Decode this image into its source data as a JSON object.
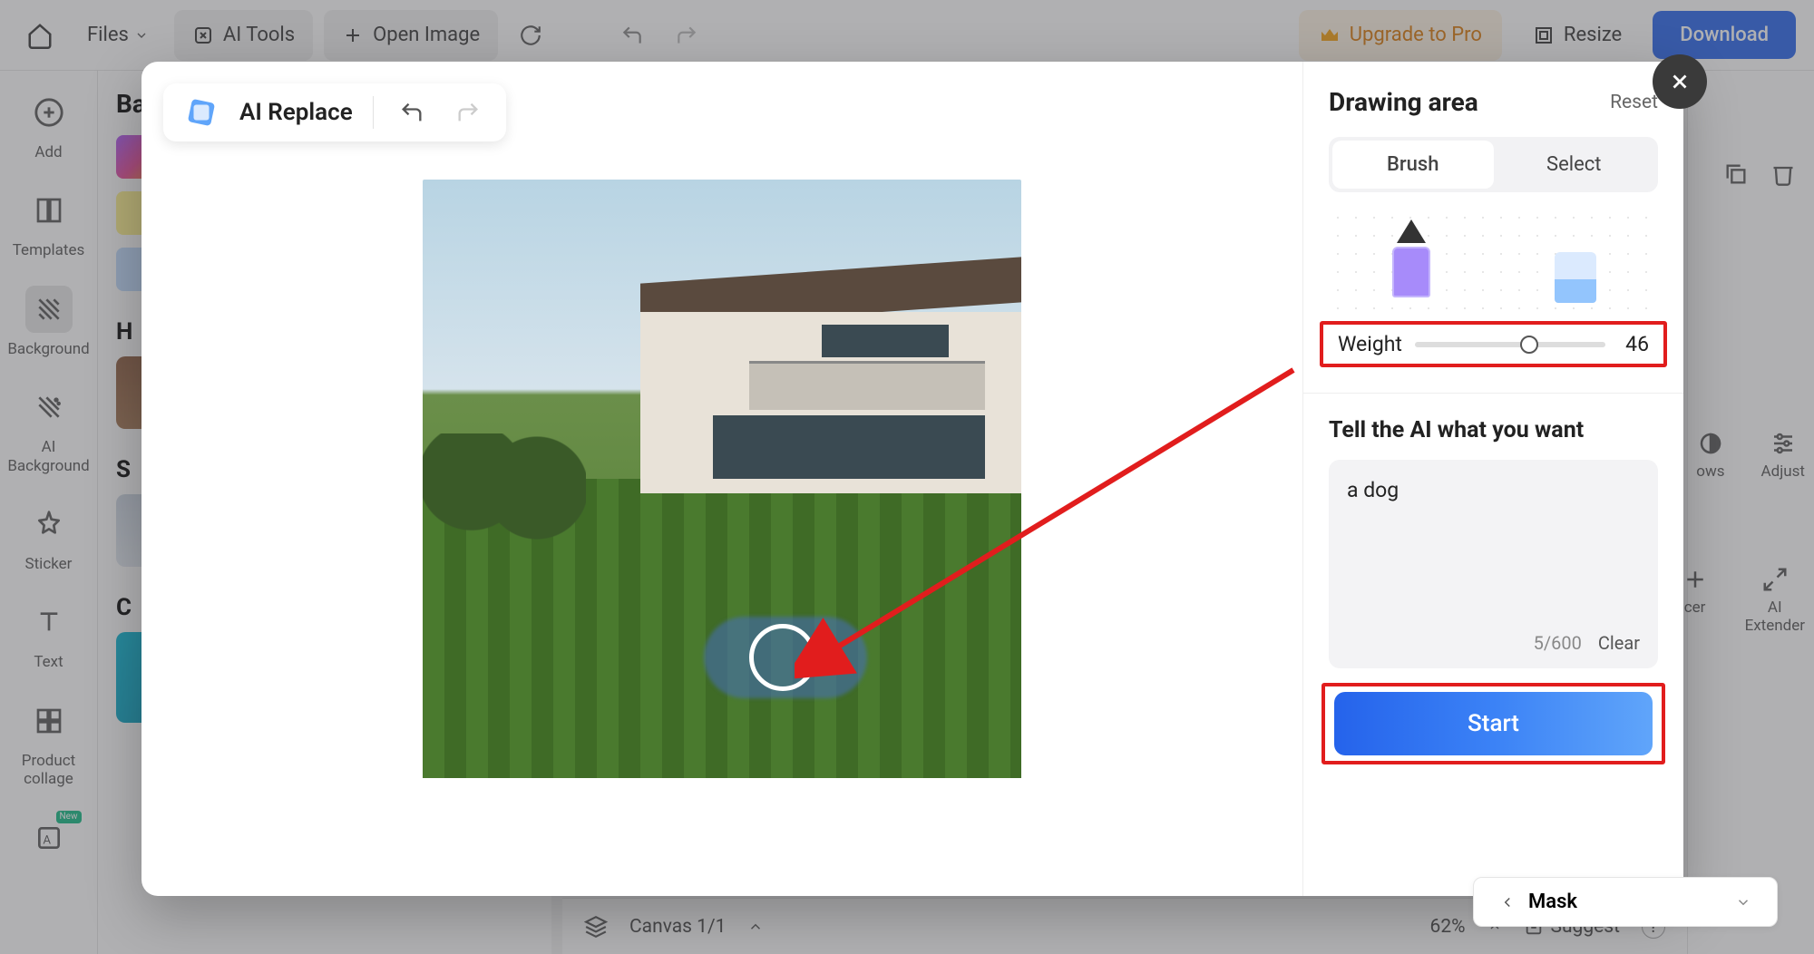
{
  "toolbar": {
    "files": "Files",
    "ai_tools": "AI Tools",
    "open_image": "Open Image",
    "upgrade": "Upgrade to Pro",
    "resize": "Resize",
    "download": "Download"
  },
  "sidebar": {
    "items": [
      {
        "label": "Add"
      },
      {
        "label": "Templates"
      },
      {
        "label": "Background"
      },
      {
        "label": "AI\nBackground"
      },
      {
        "label": "Sticker"
      },
      {
        "label": "Text"
      },
      {
        "label": "Product\ncollage"
      }
    ]
  },
  "bg_panel": {
    "title_initial": "B",
    "sections": [
      "H",
      "S",
      "C"
    ]
  },
  "right_props": {
    "items": [
      "ows",
      "Adjust",
      "cer",
      "AI\nExtender"
    ]
  },
  "bottom": {
    "canvas": "Canvas 1/1",
    "zoom": "62%",
    "suggest": "Suggest",
    "help": "?",
    "mask": "Mask"
  },
  "modal": {
    "title": "AI Replace",
    "panel": {
      "title": "Drawing area",
      "reset": "Reset",
      "tabs": {
        "brush": "Brush",
        "select": "Select"
      },
      "weight_label": "Weight",
      "weight_value": "46",
      "prompt_title": "Tell the AI what you want",
      "prompt_value": "a dog",
      "char_count": "5/600",
      "clear": "Clear",
      "start": "Start"
    }
  }
}
